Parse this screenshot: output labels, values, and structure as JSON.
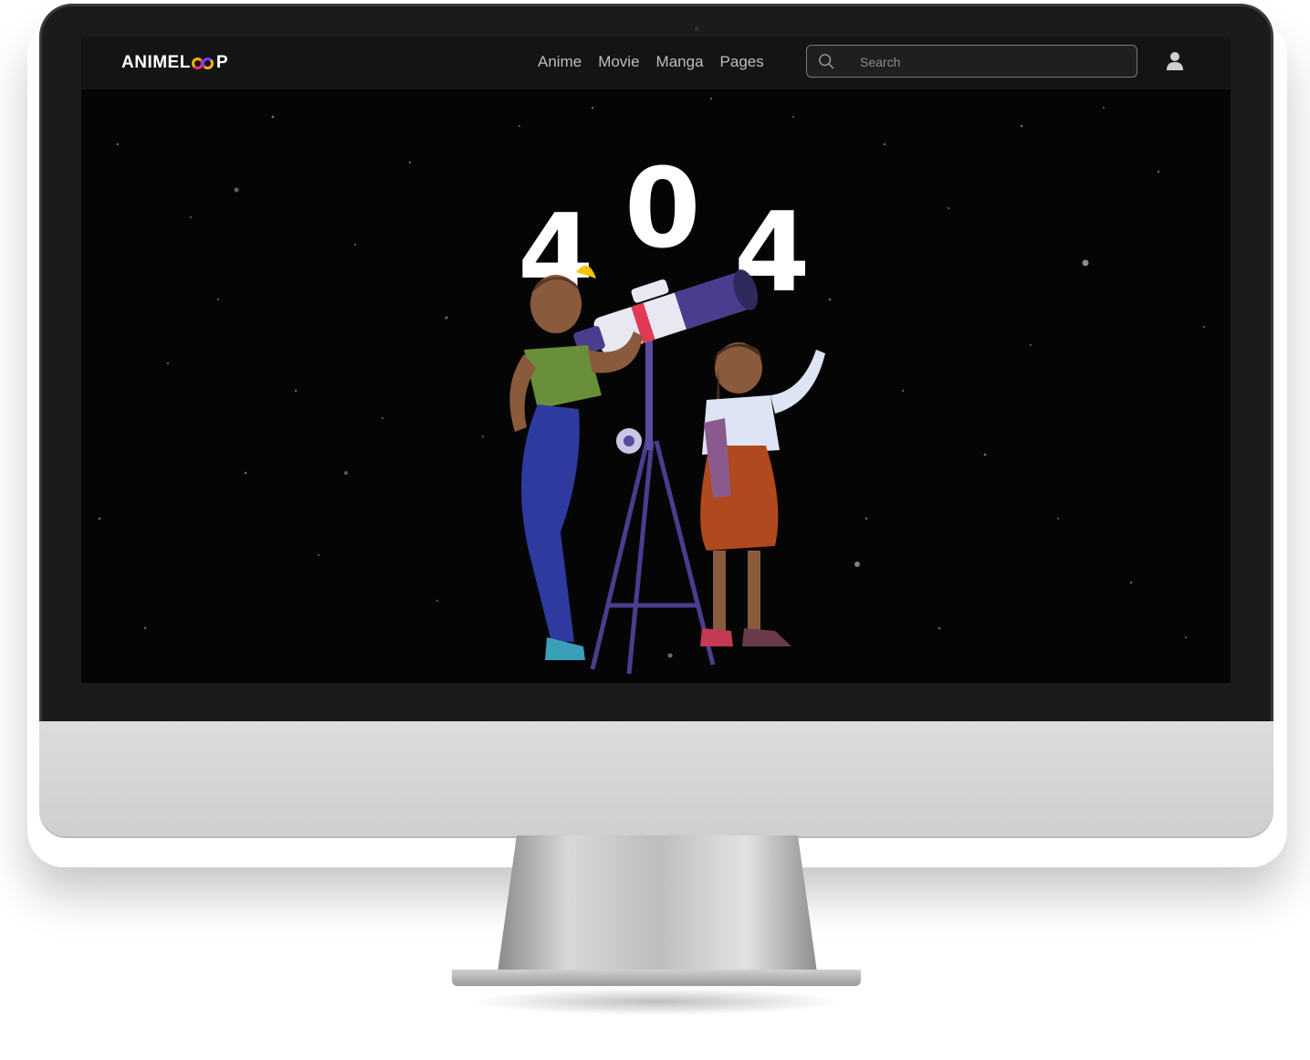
{
  "navbar": {
    "logo_text_a": "ANIMEL",
    "logo_text_b": "P",
    "links": [
      "Anime",
      "Movie",
      "Manga",
      "Pages"
    ],
    "search_placeholder": "Search",
    "icons": [
      "search-icon",
      "user-icon"
    ]
  },
  "hero": {
    "error_digits": [
      "4",
      "0",
      "4"
    ]
  },
  "colors": {
    "navbar_bg": "#141414",
    "screen_bg": "#050505",
    "logo_loop_yellow": "#f5b400",
    "logo_loop_pink": "#e8336b",
    "logo_loop_purple": "#7a3cff",
    "nav_text": "#bdbdbd"
  }
}
